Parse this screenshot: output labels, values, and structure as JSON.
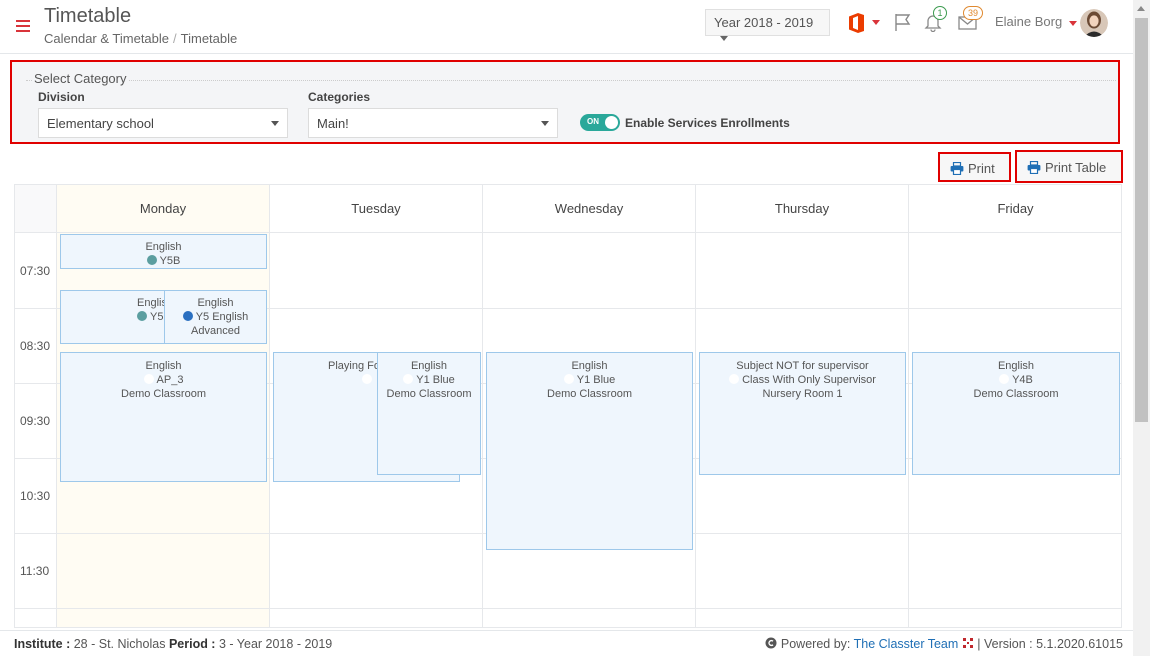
{
  "header": {
    "title": "Timetable",
    "breadcrumb": [
      "Calendar & Timetable",
      "Timetable"
    ],
    "year_selector": "Year 2018 - 2019",
    "bell_badge": "1",
    "mail_badge": "39",
    "user_name": "Elaine Borg"
  },
  "filters": {
    "legend": "Select Category",
    "division_label": "Division",
    "division_value": "Elementary school",
    "categories_label": "Categories",
    "categories_value": "Main!",
    "toggle_state": "ON",
    "toggle_label": "Enable Services Enrollments"
  },
  "actions": {
    "print_label": "Print",
    "print_table_label": "Print Table"
  },
  "calendar": {
    "days": [
      "Monday",
      "Tuesday",
      "Wednesday",
      "Thursday",
      "Friday"
    ],
    "times": [
      "07:30",
      "08:30",
      "09:30",
      "10:30",
      "11:30"
    ],
    "events": {
      "mon1": {
        "subject": "English",
        "group": "Y5B"
      },
      "mon2": {
        "subject": "English",
        "group": "Y5"
      },
      "mon3": {
        "subject": "English",
        "group": "Y5 English",
        "extra": "Advanced"
      },
      "mon4": {
        "subject": "English",
        "group": "AP_3",
        "room": "Demo Classroom"
      },
      "tue1": {
        "subject": "Playing Fo"
      },
      "tue2": {
        "subject": "English",
        "group": "Y1 Blue",
        "room": "Demo Classroom"
      },
      "wed1": {
        "subject": "English",
        "group": "Y1 Blue",
        "room": "Demo Classroom"
      },
      "thu1": {
        "subject": "Subject NOT for supervisor",
        "group": "Class With Only Supervisor",
        "room": "Nursery Room 1"
      },
      "fri1": {
        "subject": "English",
        "group": "Y4B",
        "room": "Demo Classroom"
      }
    }
  },
  "footer": {
    "institute_label": "Institute :",
    "institute_value": "28 - St. Nicholas",
    "period_label": "Period :",
    "period_value": "3 - Year 2018 - 2019",
    "powered_by": "Powered by:",
    "team": "The Classter Team",
    "version": "| Version : 5.1.2020.61015"
  },
  "colors": {
    "accent_red": "#d9343a",
    "toggle_teal": "#2aa89a",
    "dot_teal": "#5b9ea0",
    "dot_blue": "#2a6fc0"
  }
}
